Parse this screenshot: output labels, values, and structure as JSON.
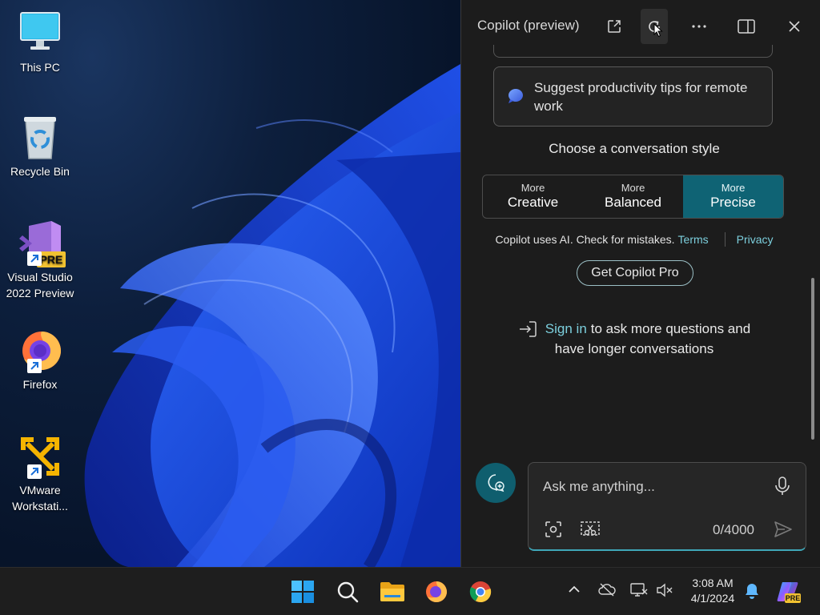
{
  "desktop": {
    "icons": [
      {
        "label": "This PC",
        "icon": "monitor-icon"
      },
      {
        "label": "Recycle Bin",
        "icon": "recycle-bin-icon"
      },
      {
        "label_line1": "Visual Studio",
        "label_line2": "2022 Preview",
        "badge": "PRE",
        "icon": "visual-studio-icon"
      },
      {
        "label": "Firefox",
        "icon": "firefox-icon"
      },
      {
        "label_line1": "VMware",
        "label_line2": "Workstati...",
        "icon": "vmware-icon"
      }
    ]
  },
  "copilot": {
    "title": "Copilot (preview)",
    "suggestion": "Suggest productivity tips for remote work",
    "style_heading": "Choose a conversation style",
    "styles": [
      {
        "small": "More",
        "large": "Creative",
        "selected": false
      },
      {
        "small": "More",
        "large": "Balanced",
        "selected": false
      },
      {
        "small": "More",
        "large": "Precise",
        "selected": true
      }
    ],
    "disclaimer": {
      "text": "Copilot uses AI. Check for mistakes.",
      "terms_link": "Terms",
      "privacy_link": "Privacy"
    },
    "pro_button": "Get Copilot Pro",
    "signin": {
      "link": "Sign in",
      "line1_rest": "to ask more questions and",
      "line2": "have longer conversations"
    },
    "compose": {
      "placeholder": "Ask me anything...",
      "char_count": "0/4000"
    },
    "accent_color": "#0f6374",
    "link_color": "#7ccfdd"
  },
  "taskbar": {
    "time": "3:08 AM",
    "date": "4/1/2024",
    "copilot_badge": "PRE"
  }
}
